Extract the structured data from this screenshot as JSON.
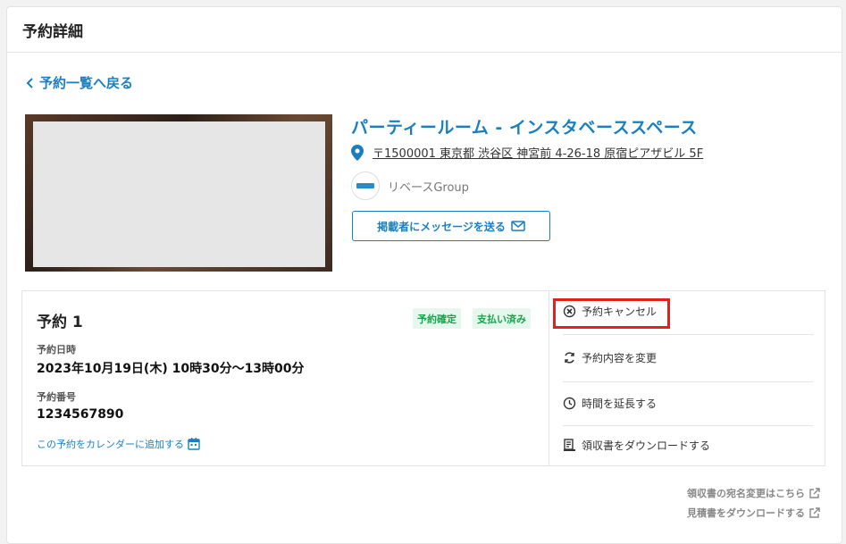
{
  "header": {
    "title": "予約詳細"
  },
  "back": {
    "label": "予約一覧へ戻る"
  },
  "venue": {
    "title": "パーティールーム - インスタベーススペース",
    "address": "〒1500001 東京都 渋谷区 神宮前 4-26-18 原宿ピアザビル 5F",
    "host_name": "リベースGroup",
    "message_button": "掲載者にメッセージを送る"
  },
  "reservation": {
    "title": "予約 1",
    "badges": {
      "confirmed": "予約確定",
      "paid": "支払い済み"
    },
    "datetime_label": "予約日時",
    "datetime_value": "2023年10月19日(木) 10時30分〜13時00分",
    "number_label": "予約番号",
    "number_value": "1234567890",
    "calendar_link": "この予約をカレンダーに追加する"
  },
  "actions": {
    "cancel": "予約キャンセル",
    "change": "予約内容を変更",
    "extend": "時間を延長する",
    "receipt": "領収書をダウンロードする"
  },
  "footer": {
    "receipt_name_link": "領収書の宛名変更はこちら",
    "estimate_link": "見積書をダウンロードする"
  },
  "colors": {
    "accent": "#1a7fc1",
    "badge_green": "#19a24c",
    "highlight_red": "#e3201b"
  }
}
